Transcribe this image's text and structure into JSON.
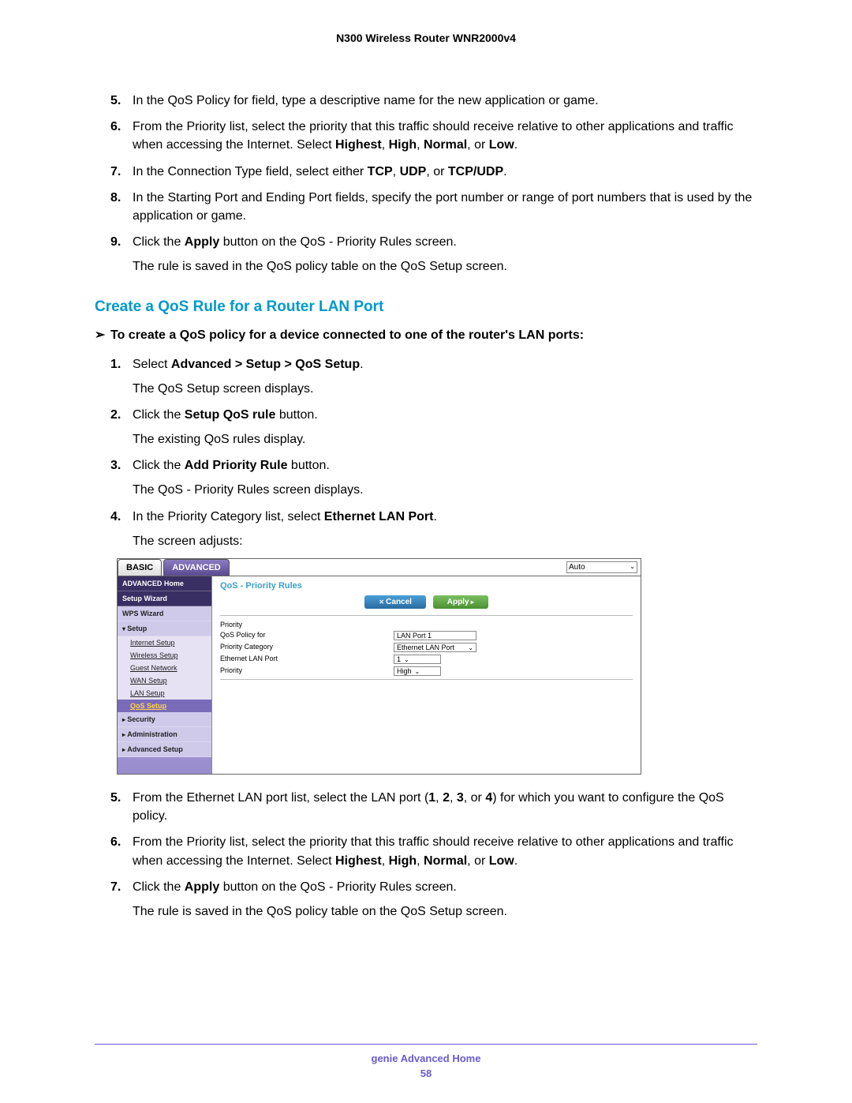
{
  "header": {
    "title": "N300 Wireless Router WNR2000v4"
  },
  "topSteps": [
    {
      "n": "5.",
      "html": "In the QoS Policy for field, type a descriptive name for the new application or game."
    },
    {
      "n": "6.",
      "html": "From the Priority list, select the priority that this traffic should receive relative to other applications and traffic when accessing the Internet. Select <b>Highest</b>, <b>High</b>, <b>Normal</b>, or <b>Low</b>."
    },
    {
      "n": "7.",
      "html": "In the Connection Type field, select either <b>TCP</b>, <b>UDP</b>, or <b>TCP/UDP</b>."
    },
    {
      "n": "8.",
      "html": "In the Starting Port and Ending Port fields, specify the port number or range of port numbers that is used by the application or game."
    },
    {
      "n": "9.",
      "html": "Click the <b>Apply</b> button on the QoS - Priority Rules screen.",
      "sub": "The rule is saved in the QoS policy table on the QoS Setup screen."
    }
  ],
  "section": {
    "heading": "Create a QoS Rule for a Router LAN Port",
    "intro": "To create a QoS policy for a device connected to one of the router's LAN ports:"
  },
  "midSteps": [
    {
      "n": "1.",
      "html": "Select <b>Advanced > Setup > QoS Setup</b>.",
      "sub": "The QoS Setup screen displays."
    },
    {
      "n": "2.",
      "html": "Click the <b>Setup QoS rule</b> button.",
      "sub": "The existing QoS rules display."
    },
    {
      "n": "3.",
      "html": "Click the <b>Add Priority Rule</b> button.",
      "sub": "The QoS - Priority Rules screen displays."
    },
    {
      "n": "4.",
      "html": "In the Priority Category list, select <b>Ethernet LAN Port</b>.",
      "sub": "The screen adjusts:"
    }
  ],
  "router": {
    "tabs": {
      "basic": "BASIC",
      "advanced": "ADVANCED"
    },
    "autoSelect": "Auto",
    "sidebar": {
      "advHome": "ADVANCED Home",
      "setupWizard": "Setup Wizard",
      "wpsWizard": "WPS Wizard",
      "setup": "Setup",
      "subs": [
        "Internet Setup",
        "Wireless Setup",
        "Guest Network",
        "WAN Setup",
        "LAN Setup",
        "QoS Setup"
      ],
      "security": "Security",
      "administration": "Administration",
      "advSetup": "Advanced Setup"
    },
    "page": {
      "title": "QoS - Priority Rules",
      "cancel": "Cancel",
      "apply": "Apply",
      "priorityHeader": "Priority",
      "rows": [
        {
          "label": "QoS Policy for",
          "value": "LAN Port 1",
          "dropdown": false,
          "wide": true
        },
        {
          "label": "Priority Category",
          "value": "Ethernet LAN Port",
          "dropdown": true,
          "wide": true
        },
        {
          "label": "Ethernet LAN Port",
          "value": "1",
          "dropdown": true,
          "wide": false
        },
        {
          "label": "Priority",
          "value": "High",
          "dropdown": true,
          "wide": false
        }
      ]
    }
  },
  "bottomSteps": [
    {
      "n": "5.",
      "html": "From the Ethernet LAN port list, select the LAN port (<b>1</b>, <b>2</b>, <b>3</b>, or <b>4</b>) for which you want to configure the QoS policy."
    },
    {
      "n": "6.",
      "html": "From the Priority list, select the priority that this traffic should receive relative to other applications and traffic when accessing the Internet. Select <b>Highest</b>, <b>High</b>, <b>Normal</b>, or <b>Low</b>."
    },
    {
      "n": "7.",
      "html": "Click the <b>Apply</b> button on the QoS - Priority Rules screen.",
      "sub": "The rule is saved in the QoS policy table on the QoS Setup screen."
    }
  ],
  "footer": {
    "section": "genie Advanced Home",
    "page": "58"
  }
}
